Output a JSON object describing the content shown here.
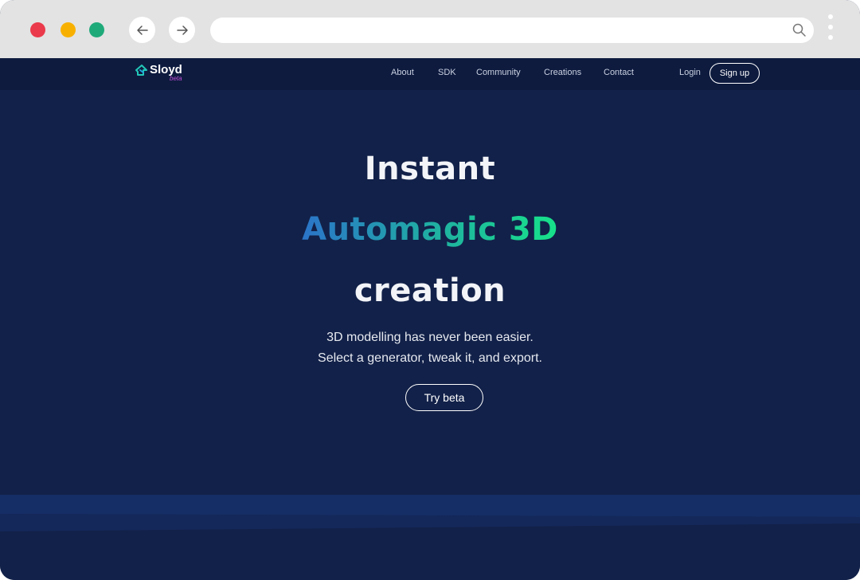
{
  "brand": {
    "name": "Sloyd",
    "tag": "beta"
  },
  "nav": {
    "about": "About",
    "sdk": "SDK",
    "community": "Community",
    "creations": "Creations",
    "contact": "Contact",
    "login": "Login",
    "signup": "Sign up"
  },
  "hero": {
    "line1": "Instant",
    "line2": "Automagic 3D",
    "line3": "creation",
    "sub1": "3D modelling has never been easier.",
    "sub2": "Select a generator, tweak it, and export.",
    "cta": "Try beta"
  },
  "colors": {
    "background": "#122149",
    "navbar": "#0e1b3f",
    "gradient_start": "#2b74c9",
    "gradient_end": "#17e28a",
    "beta_tag": "#c04fd8"
  }
}
